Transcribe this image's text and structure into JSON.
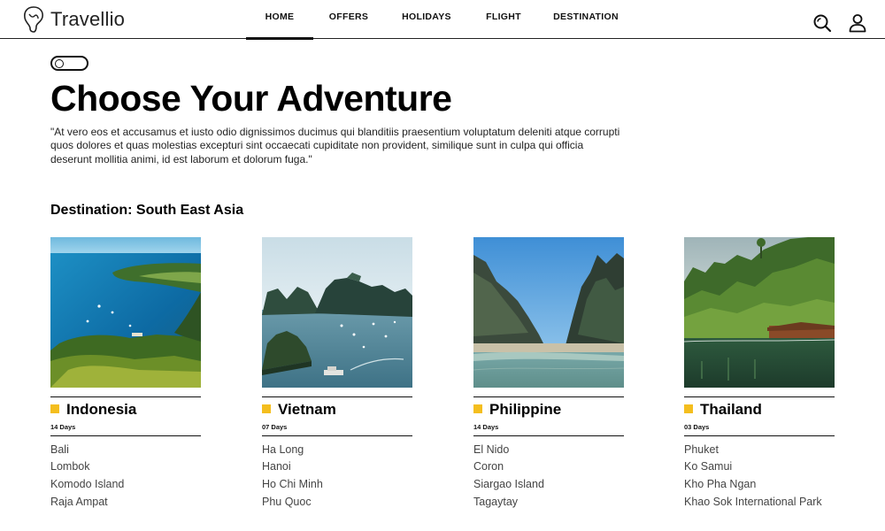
{
  "header": {
    "logo_text": "Travellio",
    "nav": [
      {
        "label": "HOME",
        "active": true
      },
      {
        "label": "OFFERS",
        "active": false
      },
      {
        "label": "HOLIDAYS",
        "active": false
      },
      {
        "label": "FLIGHT",
        "active": false
      },
      {
        "label": "DESTINATION",
        "active": false
      }
    ],
    "icons": [
      "search-icon",
      "user-icon"
    ]
  },
  "hero": {
    "title": "Choose Your Adventure",
    "intro": "\"At vero eos et accusamus et iusto odio dignissimos ducimus qui blanditiis praesentium voluptatum deleniti atque corrupti quos dolores et quas molestias excepturi sint occaecati cupiditate non provident, similique sunt in culpa qui officia deserunt mollitia animi, id est laborum et dolorum fuga.\""
  },
  "section": {
    "title": "Destination: South East Asia"
  },
  "cards": [
    {
      "title": "Indonesia",
      "days": "14 Days",
      "places": [
        "Bali",
        "Lombok",
        "Komodo Island",
        "Raja Ampat"
      ]
    },
    {
      "title": "Vietnam",
      "days": "07 Days",
      "places": [
        "Ha Long",
        "Hanoi",
        "Ho Chi Minh",
        "Phu Quoc"
      ]
    },
    {
      "title": "Philippine",
      "days": "14 Days",
      "places": [
        "El Nido",
        "Coron",
        "Siargao Island",
        "Tagaytay"
      ]
    },
    {
      "title": "Thailand",
      "days": "03 Days",
      "places": [
        "Phuket",
        "Ko Samui",
        "Kho Pha Ngan",
        "Khao Sok International Park"
      ]
    }
  ],
  "colors": {
    "accent": "#f4be1e",
    "text": "#111111"
  }
}
